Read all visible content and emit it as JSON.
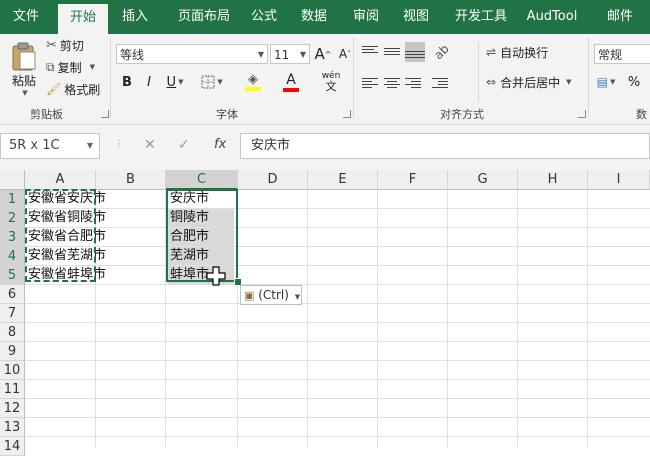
{
  "tabs": [
    {
      "label": "文件",
      "active": false
    },
    {
      "label": "开始",
      "active": true
    },
    {
      "label": "插入",
      "active": false
    },
    {
      "label": "页面布局",
      "active": false
    },
    {
      "label": "公式",
      "active": false
    },
    {
      "label": "数据",
      "active": false
    },
    {
      "label": "审阅",
      "active": false
    },
    {
      "label": "视图",
      "active": false
    },
    {
      "label": "开发工具",
      "active": false
    },
    {
      "label": "AudTool",
      "active": false
    },
    {
      "label": "邮件",
      "active": false
    }
  ],
  "clipboard": {
    "paste": "粘贴",
    "cut": "剪切",
    "copy": "复制",
    "format_painter": "格式刷",
    "group_label": "剪贴板"
  },
  "font": {
    "name": "等线",
    "size": "11",
    "grow": "A",
    "shrink": "A",
    "bold": "B",
    "italic": "I",
    "underline": "U",
    "font_color_letter": "A",
    "phonetic": "wén",
    "group_label": "字体"
  },
  "alignment": {
    "wrap_text": "自动换行",
    "merge_center": "合并后居中",
    "group_label": "对齐方式"
  },
  "number": {
    "format": "常规",
    "percent": "%",
    "group_label_partial": "数"
  },
  "colors": {
    "brand": "#217346",
    "fill_color": "#ffff00",
    "font_color": "#ff0000",
    "selection_shade": "#d9d9d9"
  },
  "formula_bar": {
    "name_box": "5R x 1C",
    "cancel": "✕",
    "enter": "✓",
    "fx": "fx",
    "content": "安庆市"
  },
  "columns": [
    "A",
    "B",
    "C",
    "D",
    "E",
    "F",
    "G",
    "H",
    "I"
  ],
  "selected_column": "C",
  "rows": [
    "1",
    "2",
    "3",
    "4",
    "5",
    "6",
    "7",
    "8",
    "9",
    "10",
    "11",
    "12",
    "13",
    "14"
  ],
  "selected_rows": [
    "1",
    "2",
    "3",
    "4",
    "5"
  ],
  "column_a": [
    "安徽省安庆市",
    "安徽省铜陵市",
    "安徽省合肥市",
    "安徽省芜湖市",
    "安徽省蚌埠市"
  ],
  "column_c": [
    "安庆市",
    "铜陵市",
    "合肥市",
    "芜湖市",
    "蚌埠市"
  ],
  "paste_options": {
    "label": "(Ctrl)",
    "icon": "clipboard-icon"
  }
}
